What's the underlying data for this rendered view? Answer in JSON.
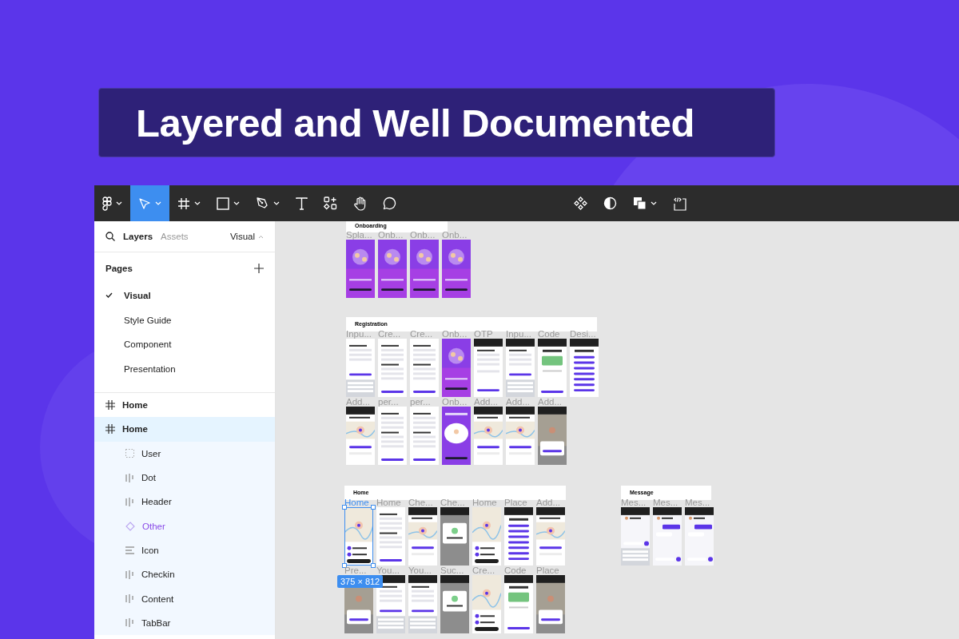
{
  "headline": "Layered and Well Documented",
  "toolbar": {
    "left_tools": [
      {
        "kind": "main-menu",
        "caret": true,
        "selected": false
      },
      {
        "kind": "move",
        "caret": true,
        "selected": true
      },
      {
        "kind": "frame",
        "caret": true,
        "selected": false
      },
      {
        "kind": "rectangle",
        "caret": true,
        "selected": false
      },
      {
        "kind": "pen",
        "caret": true,
        "selected": false
      },
      {
        "kind": "text",
        "caret": false,
        "selected": false
      },
      {
        "kind": "resources",
        "caret": false,
        "selected": false
      },
      {
        "kind": "hand",
        "caret": false,
        "selected": false
      },
      {
        "kind": "comment",
        "caret": false,
        "selected": false
      }
    ],
    "right_tools": [
      {
        "kind": "component",
        "caret": false
      },
      {
        "kind": "contrast",
        "caret": false
      },
      {
        "kind": "boolean",
        "caret": true
      },
      {
        "kind": "code",
        "caret": false
      }
    ]
  },
  "sidebar": {
    "tabs": [
      {
        "label": "Layers",
        "selected": true
      },
      {
        "label": "Assets",
        "selected": false
      }
    ],
    "page_menu": "Visual",
    "pages_title": "Pages",
    "pages": [
      {
        "label": "Visual",
        "selected": true
      },
      {
        "label": "Style Guide",
        "selected": false
      },
      {
        "label": "Component",
        "selected": false
      },
      {
        "label": "Presentation",
        "selected": false
      }
    ],
    "layers": [
      {
        "name": "Home",
        "kind": "frame",
        "selected": false
      },
      {
        "name": "Home",
        "kind": "frame",
        "selected": true,
        "children": [
          {
            "name": "User",
            "kind": "group",
            "selected": false
          },
          {
            "name": "Dot",
            "kind": "autolayout",
            "selected": false
          },
          {
            "name": "Header",
            "kind": "autolayout",
            "selected": false
          },
          {
            "name": "Other",
            "kind": "instance",
            "selected": false
          },
          {
            "name": "Icon",
            "kind": "stack",
            "selected": false
          },
          {
            "name": "Checkin",
            "kind": "autolayout",
            "selected": false
          },
          {
            "name": "Content",
            "kind": "autolayout",
            "selected": false
          },
          {
            "name": "TabBar",
            "kind": "autolayout",
            "selected": false
          }
        ]
      }
    ]
  },
  "canvas": {
    "sections": [
      {
        "title": "Onboarding",
        "rows": [
          [
            {
              "label": "Spla...",
              "kind": "purple",
              "selected": false
            },
            {
              "label": "Onb...",
              "kind": "purple",
              "selected": false
            },
            {
              "label": "Onb...",
              "kind": "purple",
              "selected": false
            },
            {
              "label": "Onb...",
              "kind": "purple",
              "selected": false
            }
          ]
        ]
      },
      {
        "title": "Registration",
        "rows": [
          [
            {
              "label": "Inpu...",
              "kind": "form-keyboard",
              "selected": false
            },
            {
              "label": "Cre...",
              "kind": "form",
              "selected": false
            },
            {
              "label": "Cre...",
              "kind": "form",
              "selected": false
            },
            {
              "label": "Onb...",
              "kind": "purple",
              "selected": false
            },
            {
              "label": "OTP",
              "kind": "dark-form",
              "selected": false
            },
            {
              "label": "Inpu...",
              "kind": "dark-keyboard",
              "selected": false
            },
            {
              "label": "Code",
              "kind": "dark-card",
              "selected": false
            },
            {
              "label": "Desi...",
              "kind": "dark-list",
              "selected": false
            }
          ],
          [
            {
              "label": "Add...",
              "kind": "dark-map",
              "selected": false
            },
            {
              "label": "per...",
              "kind": "form",
              "selected": false
            },
            {
              "label": "per...",
              "kind": "form",
              "selected": false
            },
            {
              "label": "Onb...",
              "kind": "purple-map",
              "selected": false
            },
            {
              "label": "Add...",
              "kind": "dark-map",
              "selected": false
            },
            {
              "label": "Add...",
              "kind": "dark-map",
              "selected": false
            },
            {
              "label": "Add...",
              "kind": "modal-map",
              "selected": false
            }
          ]
        ]
      },
      {
        "title": "Home",
        "rows": [
          [
            {
              "label": "Home",
              "kind": "map",
              "selected": true,
              "size": "375 × 812"
            },
            {
              "label": "Home",
              "kind": "form",
              "selected": false
            },
            {
              "label": "Che...",
              "kind": "dark-map",
              "selected": false
            },
            {
              "label": "Che...",
              "kind": "modal",
              "selected": false
            },
            {
              "label": "Home",
              "kind": "map",
              "selected": false
            },
            {
              "label": "Place",
              "kind": "dark-list",
              "selected": false
            },
            {
              "label": "Add...",
              "kind": "dark-map",
              "selected": false
            }
          ],
          [
            {
              "label": "Pre...",
              "kind": "modal-map",
              "selected": false
            },
            {
              "label": "You...",
              "kind": "dark-keyboard",
              "selected": false
            },
            {
              "label": "You...",
              "kind": "dark-keyboard",
              "selected": false
            },
            {
              "label": "Suc...",
              "kind": "modal",
              "selected": false
            },
            {
              "label": "Cre...",
              "kind": "map",
              "selected": false
            },
            {
              "label": "Code",
              "kind": "dark-card",
              "selected": false
            },
            {
              "label": "Place",
              "kind": "modal-map",
              "selected": false
            }
          ]
        ]
      },
      {
        "title": "Message",
        "rows": [
          [
            {
              "label": "Mes...",
              "kind": "chat-keyboard",
              "selected": false
            },
            {
              "label": "Mes...",
              "kind": "chat",
              "selected": false
            },
            {
              "label": "Mes...",
              "kind": "chat",
              "selected": false
            }
          ]
        ]
      }
    ]
  }
}
